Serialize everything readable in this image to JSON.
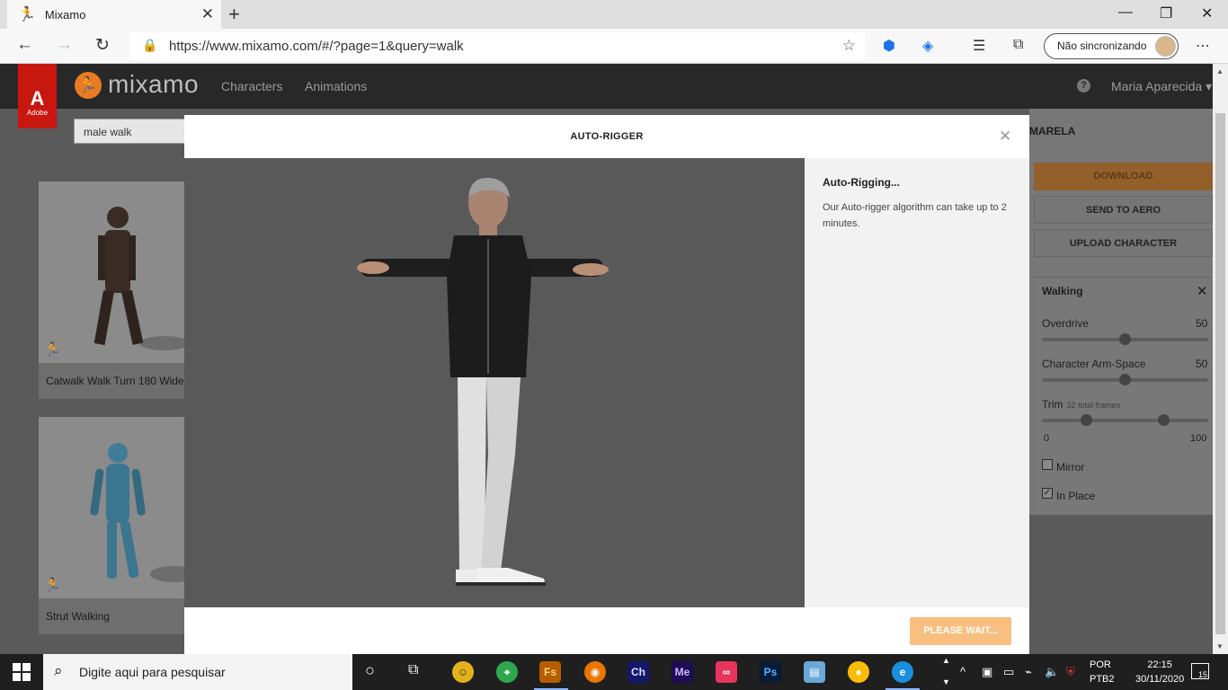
{
  "browser": {
    "tab_title": "Mixamo",
    "tab_favicon": "mixamo-runner-icon",
    "url": "https://www.mixamo.com/#/?page=1&query=walk",
    "profile_label": "Não sincronizando"
  },
  "header": {
    "adobe_text": "Adobe",
    "brand": "mixamo",
    "nav": [
      "Characters",
      "Animations"
    ],
    "help": "?",
    "user": "Maria Aparecida"
  },
  "search": {
    "value": "male walk"
  },
  "cards": [
    {
      "name": "Catwalk Walk Turn 180 Wide"
    },
    {
      "name": "Strut Walking"
    }
  ],
  "right_panel": {
    "character_title": "MARELA",
    "download": "DOWNLOAD",
    "send_to_aero": "SEND TO AERO",
    "upload_character": "UPLOAD CHARACTER",
    "section_title": "Walking",
    "overdrive": {
      "label": "Overdrive",
      "value": "50",
      "fraction": 0.5
    },
    "arm_space": {
      "label": "Character Arm-Space",
      "value": "50",
      "fraction": 0.5
    },
    "trim": {
      "label": "Trim",
      "note": "32 total frames",
      "min": "0",
      "max": "100",
      "start_fraction": 0.27,
      "end_fraction": 0.73
    },
    "mirror": {
      "label": "Mirror",
      "checked": false
    },
    "in_place": {
      "label": "In Place",
      "checked": true
    }
  },
  "modal": {
    "title": "AUTO-RIGGER",
    "status_title": "Auto-Rigging...",
    "status_text": "Our Auto-rigger algorithm can take up to 2 minutes.",
    "wait_button": "PLEASE WAIT..."
  },
  "taskbar": {
    "search_placeholder": "Digite aqui para pesquisar",
    "apps": [
      "Fs",
      "Ch",
      "Me",
      "Ps"
    ],
    "lang_line1": "POR",
    "lang_line2": "PTB2",
    "time": "22:15",
    "date": "30/11/2020",
    "notifications": "15"
  },
  "colors": {
    "accent_orange": "#e87a22",
    "adobe_red": "#c8170f",
    "download_bg": "#93602c",
    "wait_btn": "#f9bf80"
  }
}
